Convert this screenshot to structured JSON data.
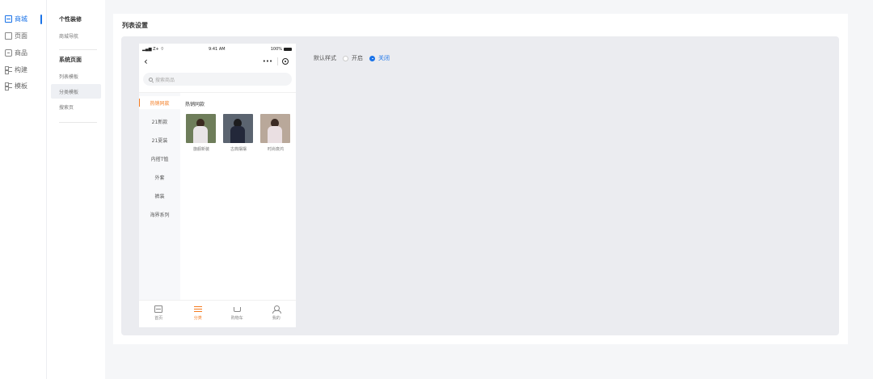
{
  "nav_primary": {
    "items": [
      {
        "label": "商城",
        "icon": "store-icon",
        "active": true
      },
      {
        "label": "页面",
        "icon": "page-icon"
      },
      {
        "label": "商品",
        "icon": "goods-icon"
      },
      {
        "label": "构建",
        "icon": "build-icon"
      },
      {
        "label": "模板",
        "icon": "template-icon"
      }
    ],
    "accent": "#1a73e8"
  },
  "nav_secondary": {
    "section1_title": "个性装修",
    "section1_items": [
      "商城导航"
    ],
    "section2_title": "系统页面",
    "section2_items": [
      "列表模板",
      "分类模板",
      "搜索页"
    ],
    "active_item": "分类模板"
  },
  "main": {
    "title": "列表设置"
  },
  "phone": {
    "status": {
      "signal": "Z+",
      "time": "9:41 AM",
      "battery": "100%"
    },
    "capsule_dots": "•••",
    "search_placeholder": "搜索商品",
    "categories": [
      "热销同款",
      "21新款",
      "21夏装",
      "内搭T恤",
      "外套",
      "裤装",
      "海界系列"
    ],
    "active_category": "热销同款",
    "section_title": "热销同款",
    "products": [
      {
        "name": "旗舰新装"
      },
      {
        "name": "古典摆摆"
      },
      {
        "name": "时尚衰鸿"
      }
    ],
    "tabs": [
      {
        "label": "首页",
        "icon": "home-icon"
      },
      {
        "label": "分类",
        "icon": "category-icon",
        "active": true
      },
      {
        "label": "购物车",
        "icon": "cart-icon"
      },
      {
        "label": "我的",
        "icon": "user-icon"
      }
    ],
    "accent": "#f47b20"
  },
  "setting": {
    "label": "默认样式",
    "options": [
      {
        "label": "开启",
        "checked": false
      },
      {
        "label": "关闭",
        "checked": true
      }
    ]
  }
}
